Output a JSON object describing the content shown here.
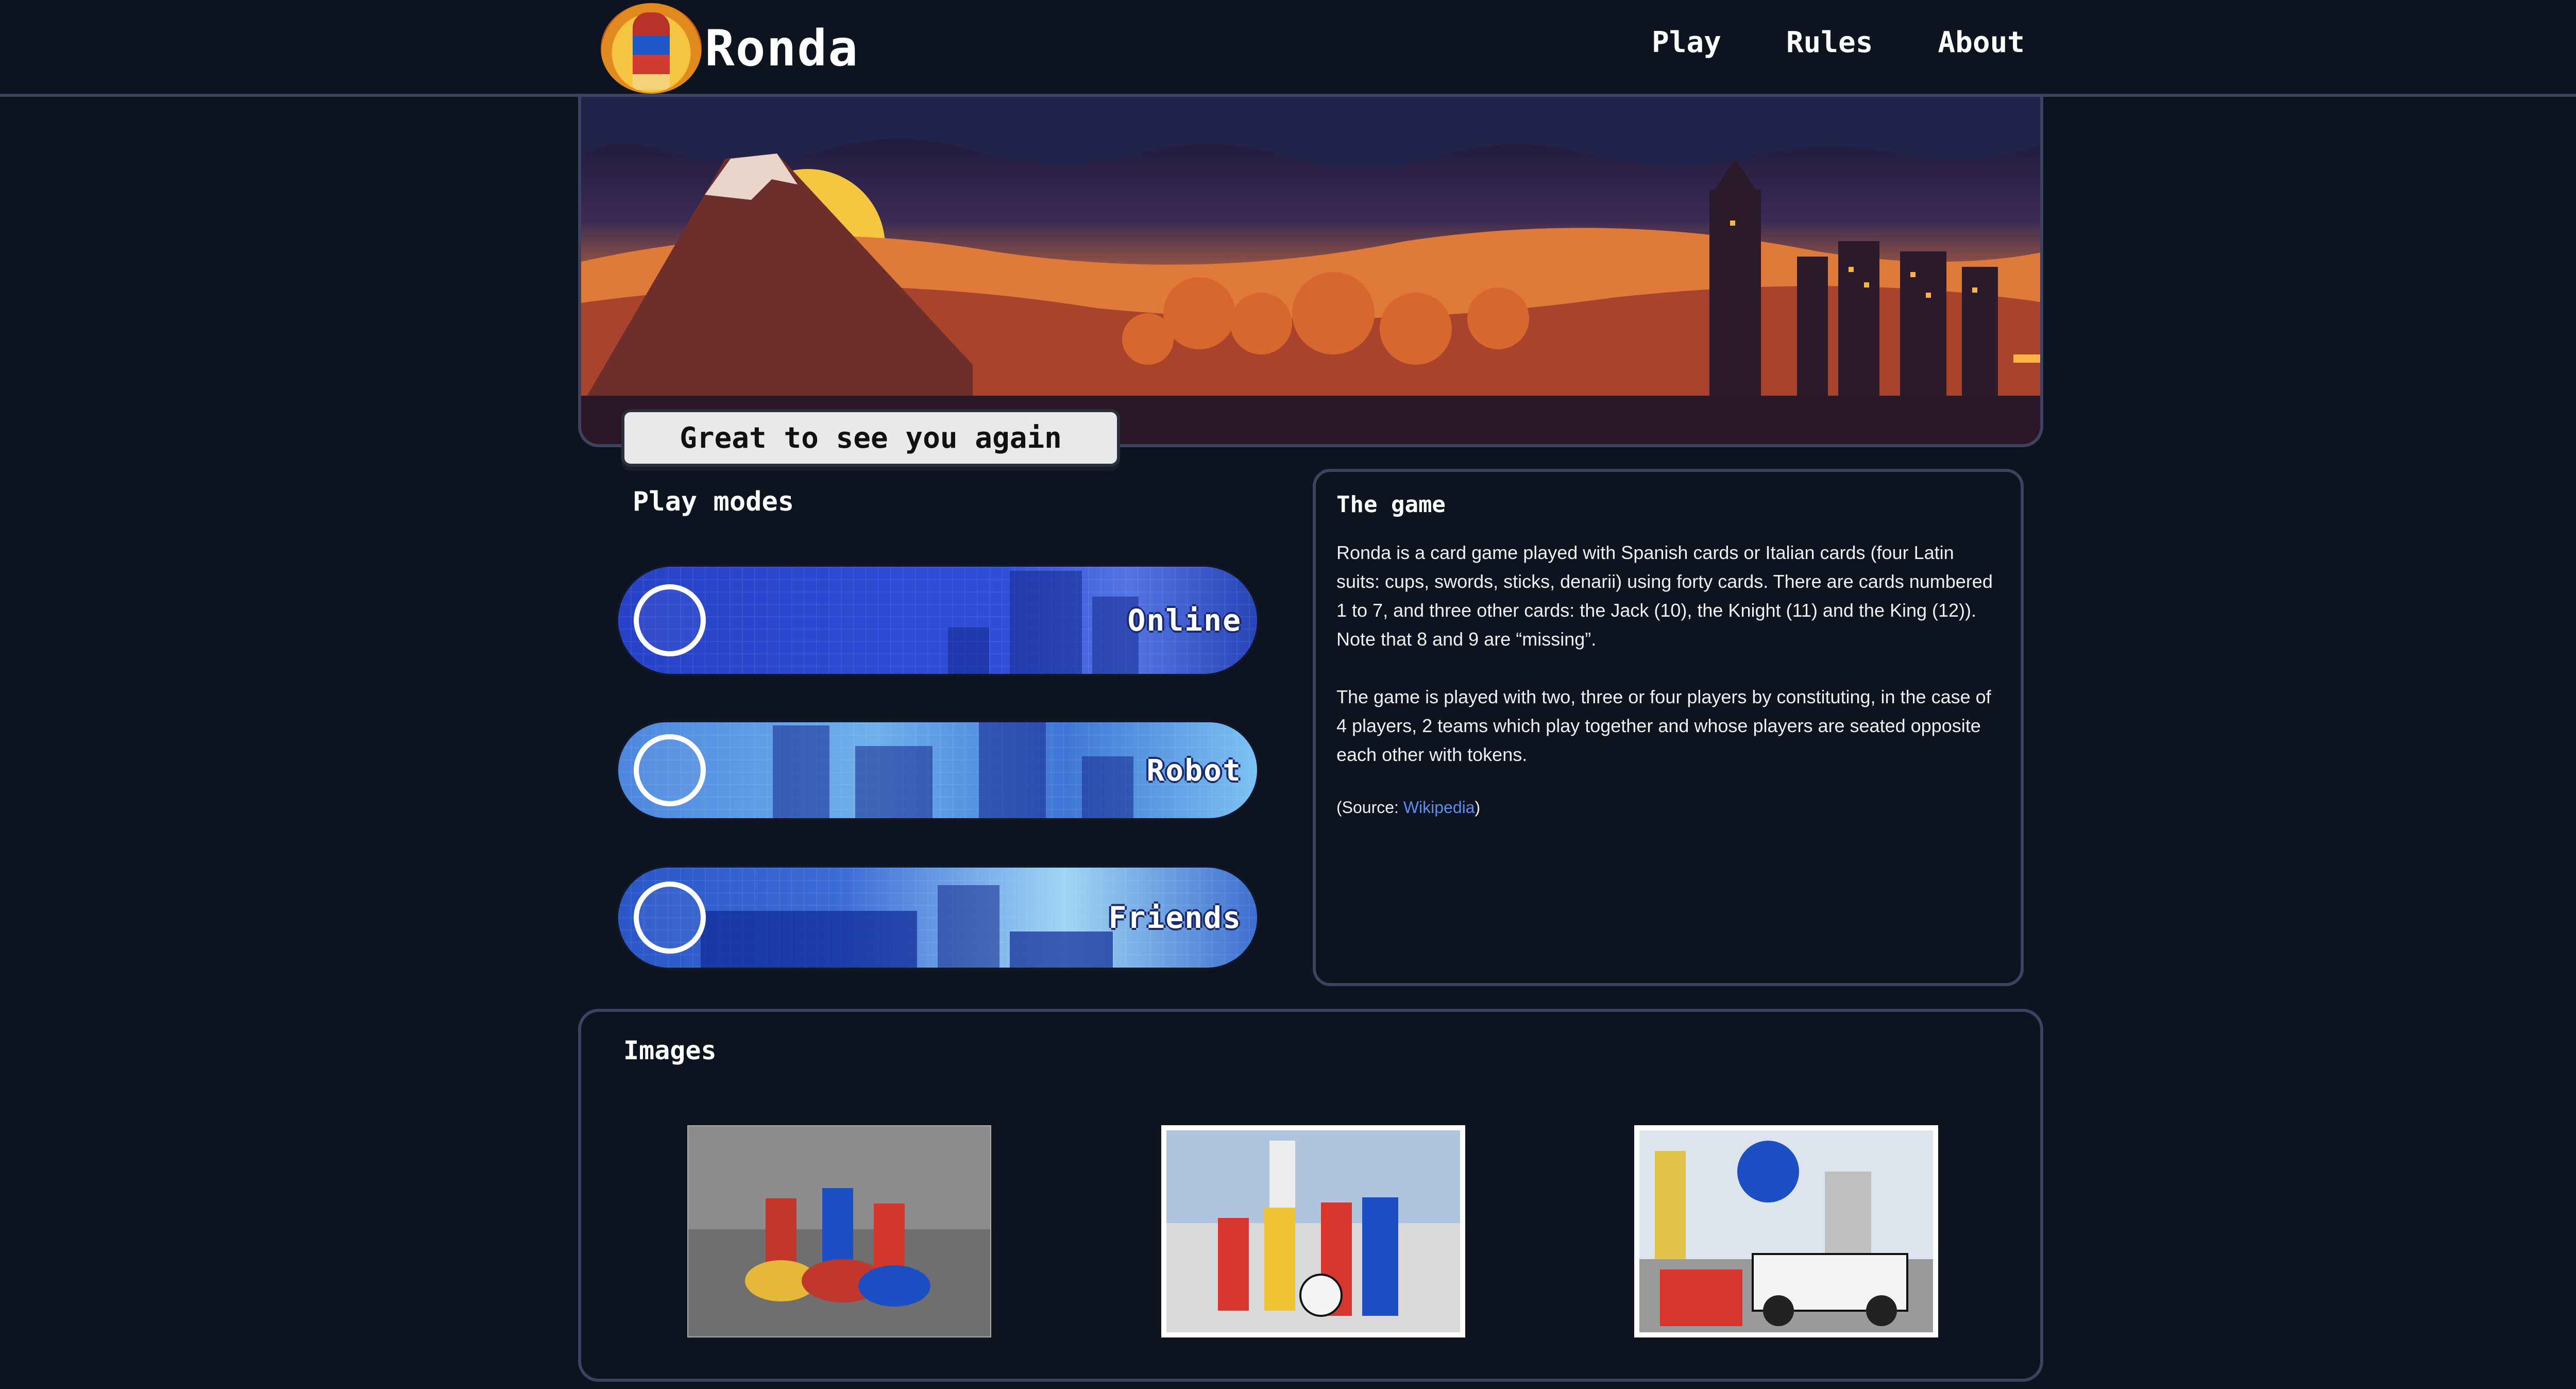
{
  "header": {
    "logo_text": "Ronda",
    "nav": [
      "Play",
      "Rules",
      "About"
    ]
  },
  "greeting": "Great to see you again",
  "play_modes": {
    "title": "Play modes",
    "modes": [
      {
        "label": "Online",
        "icon": "crystal-ball-icon"
      },
      {
        "label": "Robot",
        "icon": "robot-icon"
      },
      {
        "label": "Friends",
        "icon": "chat-bubble-icon"
      }
    ]
  },
  "game": {
    "title": "The game",
    "paragraph1": "Ronda is a card game played with Spanish cards or Italian cards (four Latin suits: cups, swords, sticks, denarii) using forty cards. There are cards numbered 1 to 7, and three other cards: the Jack (10), the Knight (11) and the King (12)). Note that 8 and 9 are “missing”.",
    "paragraph2": "The game is played with two, three or four players by constituting, in the case of 4 players, 2 teams which play together and whose players are seated opposite each other with tokens.",
    "source_prefix": "(Source: ",
    "source_link": "Wikipedia",
    "source_suffix": ")"
  },
  "images": {
    "title": "Images"
  },
  "colors": {
    "background": "#0d1420",
    "border": "#3b4360",
    "link": "#5a8ff0"
  }
}
